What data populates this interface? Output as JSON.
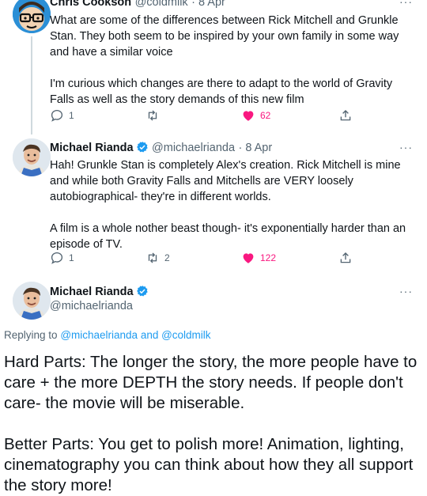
{
  "tweets": [
    {
      "name": "Chris Cookson",
      "handle": "@coldmilk",
      "date": "· 8 Apr",
      "text": "What are some of the differences between Rick Mitchell and Grunkle Stan. They both seem to be inspired by your own family in some way and have a similar voice\n\nI'm curious which changes are there to adapt to the world of Gravity Falls as well as the story demands of this new film",
      "replies": "1",
      "retweets": "",
      "likes": "62",
      "liked": true
    },
    {
      "name": "Michael Rianda",
      "handle": "@michaelrianda",
      "date": "· 8 Apr",
      "text": "Hah! Grunkle Stan is completely Alex's creation. Rick Mitchell is mine and while both Gravity Falls and Mitchells are VERY loosely autobiographical- they're in different worlds.\n\nA film is a whole nother beast though- it's exponentially harder than an episode of TV.",
      "replies": "1",
      "retweets": "2",
      "likes": "122",
      "liked": true
    }
  ],
  "main_tweet": {
    "name": "Michael Rianda",
    "handle": "@michaelrianda",
    "replying_prefix": "Replying to",
    "replying_to": "@michaelrianda and @coldmilk",
    "text": "Hard Parts: The longer the story, the more people have to care + the more DEPTH the story needs. If people don't care- the movie will be miserable.\n\nBetter Parts: You get to polish more! Animation, lighting, cinematography you can think about how they all support the story more!"
  },
  "more_label": "···",
  "colors": {
    "like": "#f91880",
    "link": "#1d9bf0",
    "verified": "#1d9bf0",
    "muted": "#536471",
    "thread_line": "#cfd9de"
  }
}
